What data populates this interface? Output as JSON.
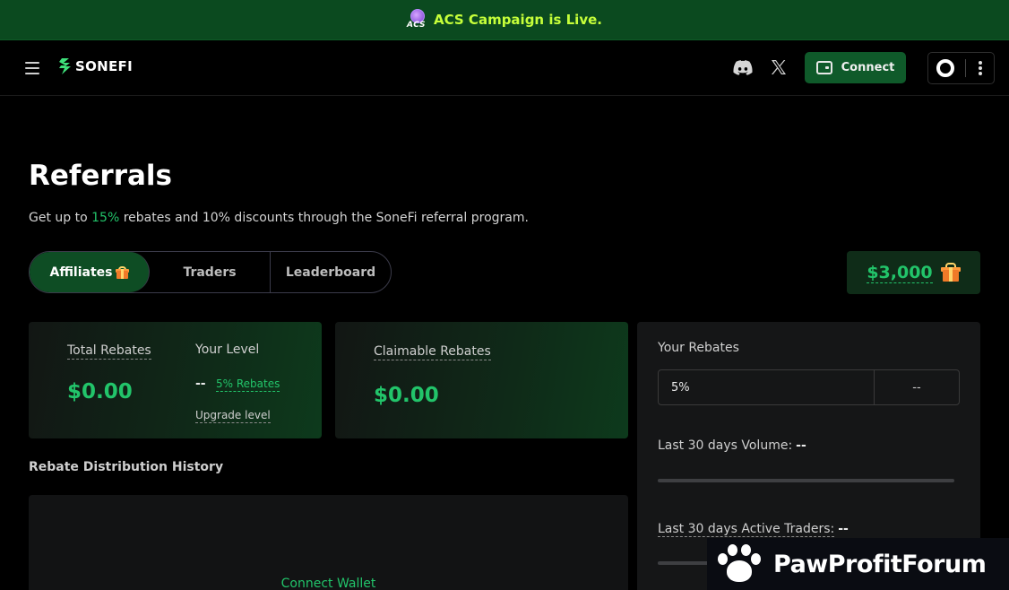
{
  "banner": {
    "logo_text": "ACS",
    "message": "ACS Campaign is Live."
  },
  "nav": {
    "logo_text": "SONEFI",
    "connect_label": "Connect",
    "icons": [
      "menu-icon",
      "discord-icon",
      "x-icon",
      "wallet-icon",
      "chain-icon",
      "more-icon"
    ]
  },
  "page": {
    "title": "Referrals",
    "subtitle_pre": "Get up to ",
    "subtitle_accent": "15%",
    "subtitle_post": " rebates and 10% discounts through the SoneFi referral program."
  },
  "tabs": [
    {
      "label": "Affiliates",
      "active": true
    },
    {
      "label": "Traders",
      "active": false
    },
    {
      "label": "Leaderboard",
      "active": false
    }
  ],
  "prize": {
    "amount": "$3,000"
  },
  "total_card": {
    "label": "Total Rebates",
    "value": "$0.00",
    "level_label": "Your Level",
    "level_value": "--",
    "level_link": "5% Rebates",
    "upgrade_link": "Upgrade level"
  },
  "claim_card": {
    "label": "Claimable Rebates",
    "value": "$0.00"
  },
  "history": {
    "title": "Rebate Distribution History",
    "connect_wallet": "Connect Wallet"
  },
  "rebates": {
    "title": "Your Rebates",
    "rate": "5%",
    "next_rate": "--",
    "volume_label": "Last 30 days Volume:",
    "volume_value": "--",
    "volume_progress": 0,
    "traders_label": "Last 30 days Active Traders:",
    "traders_value": "--",
    "traders_progress": 0
  },
  "watermark": {
    "brand": "PawProfitForum"
  },
  "colors": {
    "accent": "#22c46a",
    "banner_bg": "#0b4a1f",
    "banner_text": "#c6ff3a",
    "background": "#000000"
  }
}
